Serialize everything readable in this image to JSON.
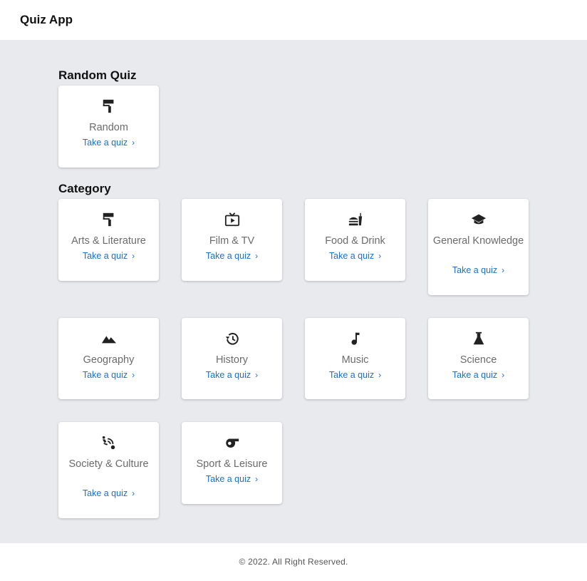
{
  "header": {
    "title": "Quiz App"
  },
  "random_section": {
    "title": "Random Quiz",
    "card": {
      "label": "Random",
      "link": "Take a quiz",
      "icon": "paint-roller-icon"
    }
  },
  "category_section": {
    "title": "Category",
    "cards": [
      {
        "label": "Arts & Literature",
        "link": "Take a quiz",
        "icon": "paint-roller-icon"
      },
      {
        "label": "Film & TV",
        "link": "Take a quiz",
        "icon": "tv-play-icon"
      },
      {
        "label": "Food & Drink",
        "link": "Take a quiz",
        "icon": "fastfood-icon"
      },
      {
        "label": "General Knowledge",
        "link": "Take a quiz",
        "icon": "graduation-cap-icon"
      },
      {
        "label": "Geography",
        "link": "Take a quiz",
        "icon": "mountains-icon"
      },
      {
        "label": "History",
        "link": "Take a quiz",
        "icon": "history-clock-icon"
      },
      {
        "label": "Music",
        "link": "Take a quiz",
        "icon": "music-note-icon"
      },
      {
        "label": "Science",
        "link": "Take a quiz",
        "icon": "flask-icon"
      },
      {
        "label": "Society & Culture",
        "link": "Take a quiz",
        "icon": "people-signal-icon"
      },
      {
        "label": "Sport & Leisure",
        "link": "Take a quiz",
        "icon": "whistle-icon"
      }
    ]
  },
  "footer": {
    "text": "© 2022. All Right Reserved."
  },
  "colors": {
    "background": "#e9eaee",
    "link": "#1a6fd6",
    "label": "#6b6b6b"
  }
}
